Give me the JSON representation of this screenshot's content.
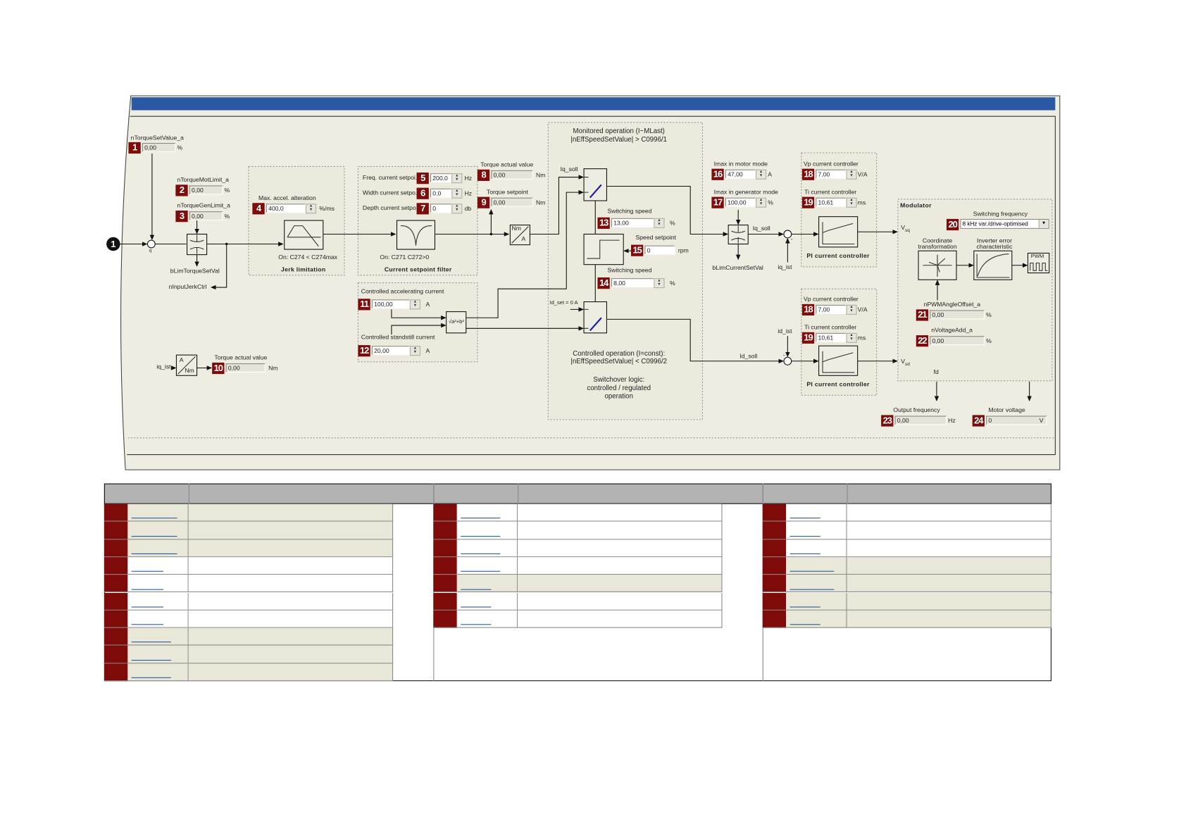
{
  "colors": {
    "title_bar": "#2b58a3",
    "panel_bg": "#eeede2",
    "badge": "#7e0a0a",
    "switch_blue": "#1a1ab0",
    "table_header": "#b3b3b3",
    "table_shaded": "#e8e7d8"
  },
  "diagram": {
    "marker": "1",
    "q": "q",
    "blim_torque": "bLimTorqueSetVal",
    "input_jerk": "nInputJerkCtrl",
    "jerk_on": "On: C274 < C274max",
    "jerk_title": "Jerk limitation",
    "filter_on": "On: C271  C272>0",
    "filter_title": "Current setpoint filter",
    "nm": "Nm",
    "a": "A",
    "iq_soll": "Iq_soll",
    "mon1": "Monitored operation (I~MLast)",
    "mon2": "|nEffSpeedSetValue| > C0996/1",
    "id_set": "Id_set = 0 A",
    "ctrl1": "Controlled operation (I=const):",
    "ctrl2": "|nEffSpeedSetValue| < C0996/2",
    "sw1": "Switchover logic:",
    "sw2": "controlled / regulated",
    "sw3": "operation",
    "blim_current": "bLimCurrentSetVal",
    "iq_ist": "iq_ist",
    "minus": "-",
    "id_ist": "id_ist",
    "id_soll": "Id_soll",
    "pi_title": "PI current controller",
    "modulator": "Modulator",
    "v": "V",
    "sq": "sq",
    "sd": "sd",
    "coord1": "Coordinate",
    "coord2": "transformation",
    "inv1": "Inverter error",
    "inv2": "characteristic",
    "pwm": "PWM",
    "fd": "fd",
    "sqrt": "√a²+b²"
  },
  "params": {
    "p1": {
      "num": "1",
      "label": "nTorqueSetValue_a",
      "value": "0,00",
      "unit": "%"
    },
    "p2": {
      "num": "2",
      "label": "nTorqueMotLimit_a",
      "value": "0,00",
      "unit": "%"
    },
    "p3": {
      "num": "3",
      "label": "nTorqueGenLimit_a",
      "value": "0,00",
      "unit": "%"
    },
    "p4": {
      "num": "4",
      "label": "Max. accel. alteration",
      "value": "400,0",
      "unit": "%/ms"
    },
    "p5": {
      "num": "5",
      "label": "Freq. current setpoi...",
      "value": "200,0",
      "unit": "Hz"
    },
    "p6": {
      "num": "6",
      "label": "Width current setpo...",
      "value": "0,0",
      "unit": "Hz"
    },
    "p7": {
      "num": "7",
      "label": "Depth current setpo...",
      "value": "0",
      "unit": "db"
    },
    "p8": {
      "num": "8",
      "label": "Torque actual value",
      "value": "0,00",
      "unit": "Nm"
    },
    "p9": {
      "num": "9",
      "label": "Torque setpoint",
      "value": "0,00",
      "unit": "Nm"
    },
    "p10": {
      "num": "10",
      "label": "Torque actual value",
      "value": "0,00",
      "unit": "Nm"
    },
    "p11": {
      "num": "11",
      "label": "Controlled accelerating current",
      "value": "100,00",
      "unit": "A"
    },
    "p12": {
      "num": "12",
      "label": "Controlled standstill current",
      "value": "20,00",
      "unit": "A"
    },
    "p13": {
      "num": "13",
      "label": "Switching speed",
      "value": "13,00",
      "unit": "%"
    },
    "p14": {
      "num": "14",
      "label": "Switching speed",
      "value": "8,00",
      "unit": "%"
    },
    "p15": {
      "num": "15",
      "label": "Speed setpoint",
      "value": "0",
      "unit": "rpm"
    },
    "p16": {
      "num": "16",
      "label": "Imax in motor mode",
      "value": "47,00",
      "unit": "A"
    },
    "p17": {
      "num": "17",
      "label": "Imax in generator mode",
      "value": "100,00",
      "unit": "%"
    },
    "p18": {
      "num": "18",
      "label": "Vp current controller",
      "value": "7,00",
      "unit": "V/A"
    },
    "p19": {
      "num": "19",
      "label": "Ti current controller",
      "value": "10,61",
      "unit": "ms"
    },
    "p20": {
      "num": "20",
      "label": "Switching frequency",
      "value": "8 kHz var./drive-optimised",
      "unit": ""
    },
    "p21": {
      "num": "21",
      "label": "nPWMAngleOffset_a",
      "value": "0,00",
      "unit": "%"
    },
    "p22": {
      "num": "22",
      "label": "nVoltageAdd_a",
      "value": "0,00",
      "unit": "%"
    },
    "p23": {
      "num": "23",
      "label": "Output frequency",
      "value": "0,00",
      "unit": "Hz"
    },
    "p24": {
      "num": "24",
      "label": "Motor voltage",
      "value": "0",
      "unit": "V"
    }
  },
  "table": {
    "groups": [
      {
        "rows": [
          {
            "shaded": true
          },
          {
            "shaded": true
          },
          {
            "shaded": true
          },
          {
            "shaded": false
          },
          {
            "shaded": false
          },
          {
            "shaded": false
          },
          {
            "shaded": false
          },
          {
            "shaded": true
          },
          {
            "shaded": true
          },
          {
            "shaded": true
          }
        ]
      },
      {
        "rows": [
          {
            "shaded": false
          },
          {
            "shaded": false
          },
          {
            "shaded": false
          },
          {
            "shaded": false
          },
          {
            "shaded": true
          },
          {
            "shaded": false
          },
          {
            "shaded": false
          }
        ]
      },
      {
        "rows": [
          {
            "shaded": false
          },
          {
            "shaded": false
          },
          {
            "shaded": false
          },
          {
            "shaded": true
          },
          {
            "shaded": true
          },
          {
            "shaded": true
          },
          {
            "shaded": true
          }
        ]
      }
    ]
  }
}
